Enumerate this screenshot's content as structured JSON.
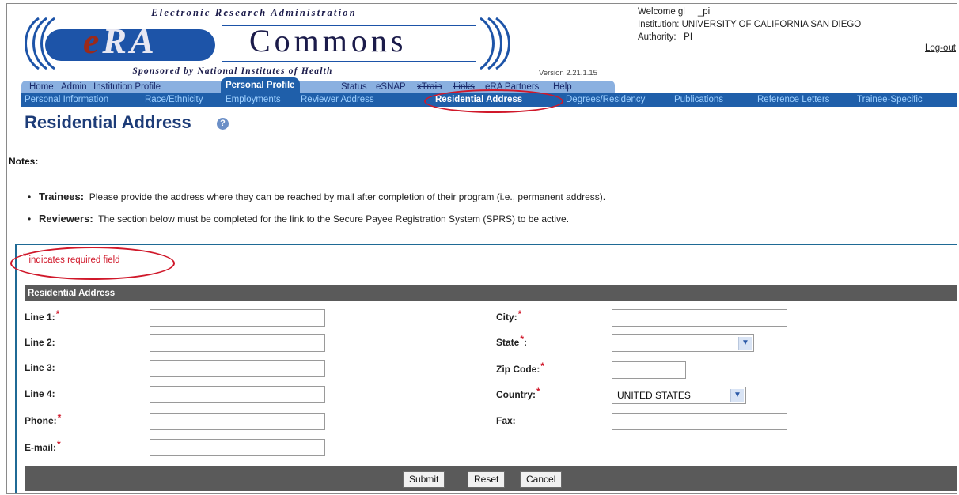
{
  "logo": {
    "tagline_top": "Electronic Research Administration",
    "brand_era_e": "e",
    "brand_era_rest": "RA",
    "brand_commons": "Commons",
    "tagline_bottom": "Sponsored by National Institutes of Health",
    "version": "Version 2.21.1.15"
  },
  "user": {
    "welcome": "Welcome gl     _pi",
    "institution": "Institution: UNIVERSITY OF CALIFORNIA SAN DIEGO",
    "authority": "Authority:   PI",
    "logout": "Log-out"
  },
  "main_tabs": [
    "Home",
    "Admin",
    "Institution Profile",
    "Personal Profile",
    "Status",
    "eSNAP",
    "xTrain",
    "Links",
    "eRA Partners",
    "Help"
  ],
  "active_main_tab": "Personal Profile",
  "sub_tabs": [
    "Personal Information",
    "Race/Ethnicity",
    "Employments",
    "Reviewer Address",
    "Residential Address",
    "Degrees/Residency",
    "Publications",
    "Reference Letters",
    "Trainee-Specific"
  ],
  "active_sub_tab": "Residential Address",
  "page": {
    "title": "Residential Address",
    "help_icon": "question-mark-icon"
  },
  "notes": {
    "heading": "Notes:",
    "items": [
      {
        "label": "Trainees:",
        "text": "Please provide the address where they can be reached by mail after completion of their program (i.e., permanent address)."
      },
      {
        "label": "Reviewers:",
        "text": "The section below must be completed for the link to the Secure Payee Registration System (SPRS) to be active."
      }
    ]
  },
  "form": {
    "required_note": "indicates required field",
    "section_title": "Residential Address",
    "left_fields": [
      {
        "label": "Line 1:",
        "required": true,
        "value": ""
      },
      {
        "label": "Line 2:",
        "required": false,
        "value": ""
      },
      {
        "label": "Line 3:",
        "required": false,
        "value": ""
      },
      {
        "label": "Line 4:",
        "required": false,
        "value": ""
      },
      {
        "label": "Phone:",
        "required": true,
        "value": ""
      },
      {
        "label": "E-mail:",
        "required": true,
        "value": ""
      }
    ],
    "city_label": "City:",
    "state_label": "State",
    "state_label_suffix": ":",
    "zip_label": "Zip Code:",
    "country_label": "Country:",
    "country_value": "UNITED STATES",
    "fax_label": "Fax:",
    "buttons": {
      "submit": "Submit",
      "reset": "Reset",
      "cancel": "Cancel"
    }
  },
  "colors": {
    "tab_blue": "#1f5faa",
    "tab_light": "#8ab0e0",
    "title_blue": "#1d3c78",
    "required_red": "#d0182a",
    "band_gray": "#5a5a5a",
    "panel_border": "#1f6a95"
  }
}
